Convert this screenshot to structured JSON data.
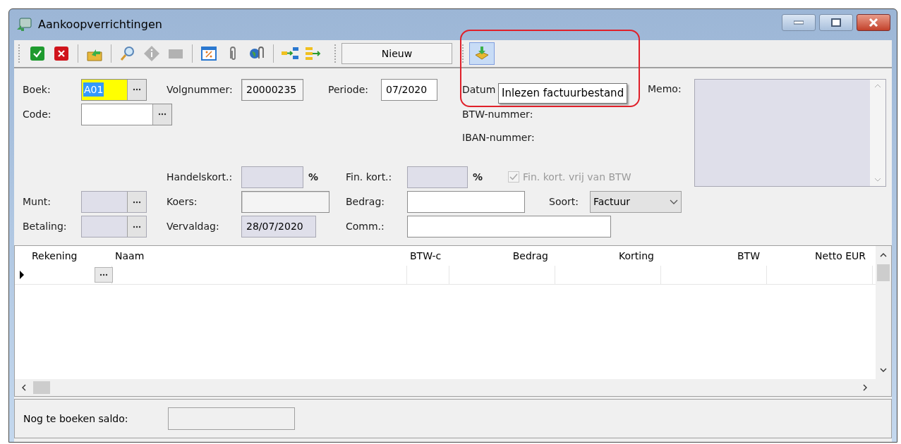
{
  "window": {
    "title": "Aankoopverrichtingen"
  },
  "toolbar": {
    "groups": [
      [
        {
          "kind": "approve",
          "disabled": false
        },
        {
          "kind": "cancel",
          "disabled": false
        }
      ],
      [
        {
          "kind": "export",
          "disabled": false
        }
      ],
      [
        {
          "kind": "search",
          "disabled": false
        },
        {
          "kind": "info",
          "disabled": true
        },
        {
          "kind": "stop",
          "disabled": true
        }
      ],
      [
        {
          "kind": "percent",
          "disabled": false
        },
        {
          "kind": "attach",
          "disabled": false
        },
        {
          "kind": "globe-attach",
          "disabled": false
        }
      ],
      [
        {
          "kind": "move-in",
          "disabled": false
        },
        {
          "kind": "move-out",
          "disabled": false
        }
      ]
    ],
    "status": "Nieuw",
    "import_button": {
      "selected": true
    },
    "tooltip": "Inlezen factuurbestand"
  },
  "form": {
    "fields": [
      {
        "kind": "lookup",
        "label": "Boek:",
        "value": "A01",
        "focused": true,
        "readonly": false,
        "disabled": false
      },
      {
        "kind": "text",
        "label": "Volgnummer:",
        "value": "20000235",
        "focused": false,
        "readonly": true,
        "disabled": false
      },
      {
        "kind": "text",
        "label": "Periode:",
        "value": "07/2020",
        "focused": false,
        "readonly": false,
        "disabled": false
      },
      {
        "kind": "label",
        "label": "Datum"
      },
      {
        "kind": "lookup",
        "label": "Code:",
        "focused": false,
        "readonly": false,
        "disabled": false
      },
      {
        "kind": "label",
        "label": "BTW-nummer:"
      },
      {
        "kind": "label",
        "label": "IBAN-nummer:"
      },
      {
        "kind": "text",
        "label": "Handelskort.:",
        "suffix": "%",
        "focused": false,
        "readonly": false,
        "disabled": true
      },
      {
        "kind": "text",
        "label": "Fin. kort.:",
        "suffix": "%",
        "focused": false,
        "readonly": false,
        "disabled": true
      },
      {
        "kind": "checkbox",
        "label": "Fin. kort. vrij van BTW",
        "checked": true,
        "disabled": true
      },
      {
        "kind": "lookup",
        "label": "Munt:",
        "focused": false,
        "readonly": false,
        "disabled": true
      },
      {
        "kind": "text",
        "label": "Koers:",
        "focused": false,
        "readonly": true,
        "disabled": false
      },
      {
        "kind": "text",
        "label": "Bedrag:",
        "focused": false,
        "readonly": false,
        "disabled": false
      },
      {
        "kind": "select",
        "label": "Soort:",
        "value": "Factuur"
      },
      {
        "kind": "lookup",
        "label": "Betaling:",
        "focused": false,
        "readonly": false,
        "disabled": true
      },
      {
        "kind": "text",
        "label": "Vervaldag:",
        "value": "28/07/2020",
        "focused": false,
        "readonly": false,
        "disabled": true
      },
      {
        "kind": "text",
        "label": "Comm.:",
        "focused": false,
        "readonly": false,
        "disabled": false
      }
    ],
    "memo": {
      "label": "Memo:",
      "disabled": true
    }
  },
  "grid": {
    "columns": [
      {
        "label": "Rekening"
      },
      {
        "label": "Naam"
      },
      {
        "label": "BTW-c"
      },
      {
        "label": "Bedrag"
      },
      {
        "label": "Korting"
      },
      {
        "label": "BTW"
      },
      {
        "label": "Netto EUR"
      }
    ],
    "rows": [
      {
        "current": true
      }
    ]
  },
  "footer": {
    "label": "Nog te boeken saldo:"
  }
}
